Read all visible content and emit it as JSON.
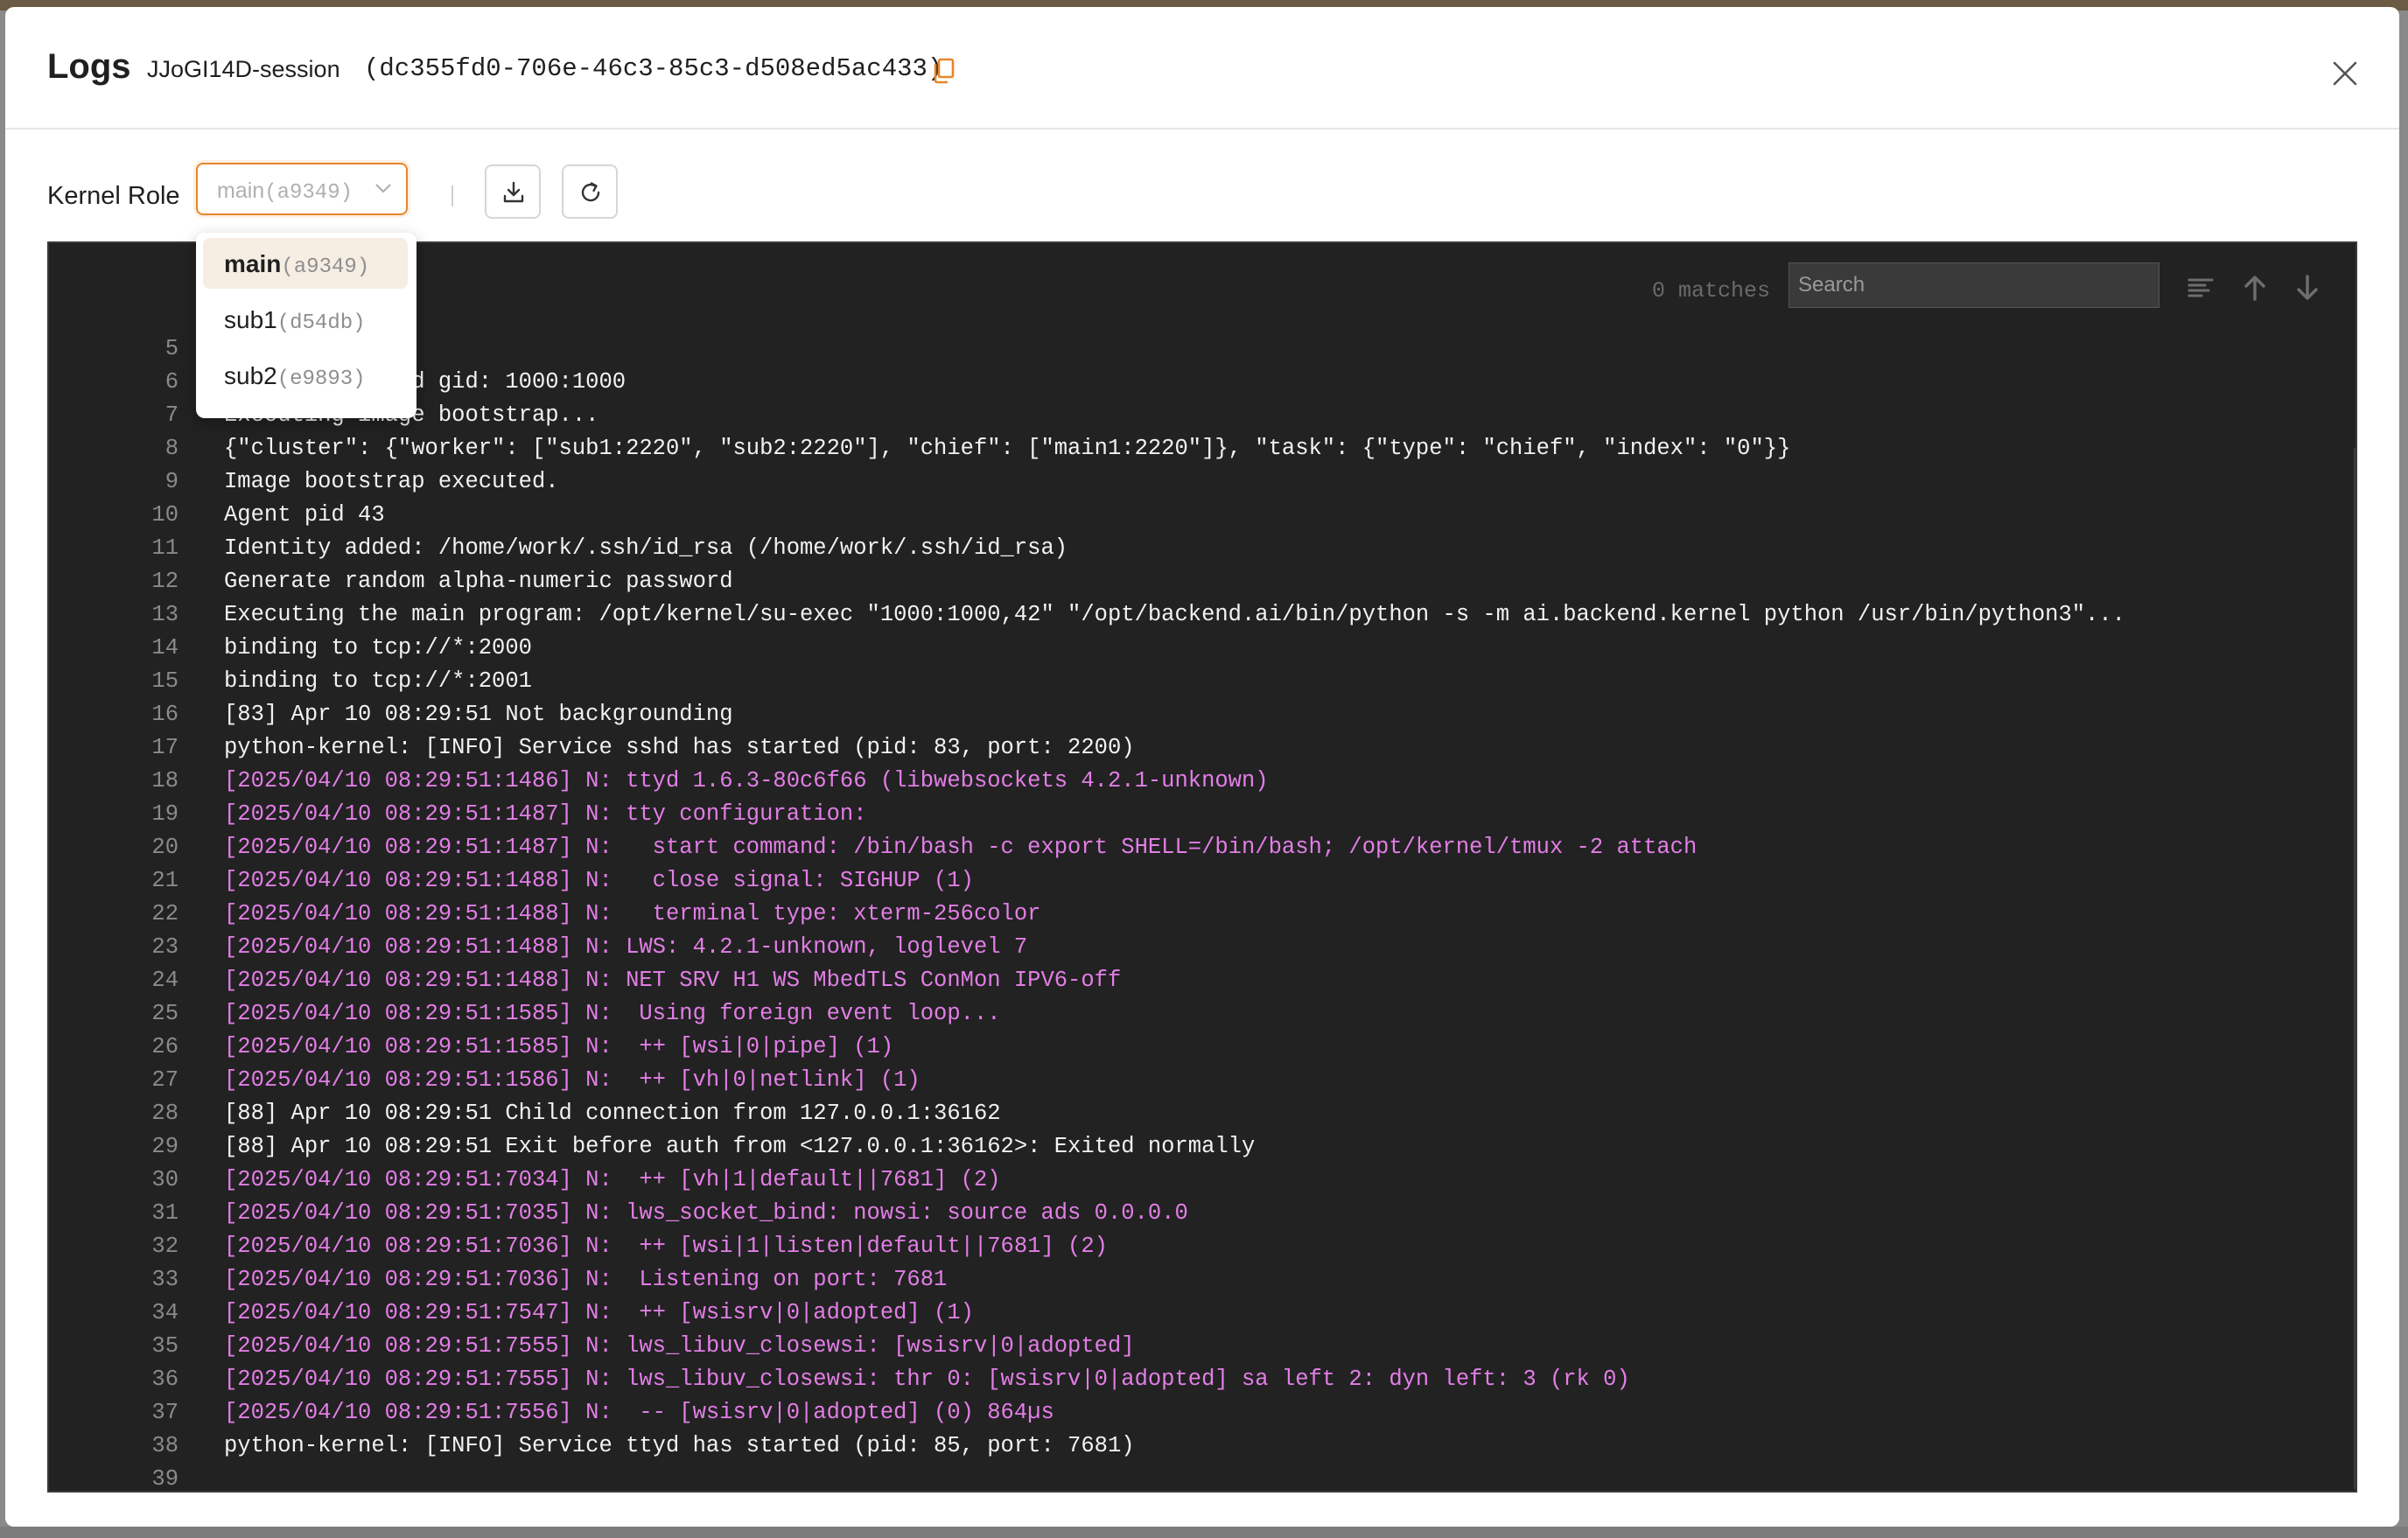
{
  "modal": {
    "title": "Logs",
    "session_name": "JJoGI14D-session",
    "session_id": "(dc355fd0-706e-46c3-85c3-d508ed5ac433)"
  },
  "toolbar": {
    "kernel_role_label": "Kernel Role",
    "selected_role": {
      "name": "main",
      "id": "(a9349)"
    }
  },
  "role_options": [
    {
      "name": "main",
      "id": "(a9349)",
      "selected": true
    },
    {
      "name": "sub1",
      "id": "(d54db)",
      "selected": false
    },
    {
      "name": "sub2",
      "id": "(e9893)",
      "selected": false
    }
  ],
  "log_search": {
    "matches": "0 matches",
    "placeholder": "Search"
  },
  "colors": {
    "accent": "#e8862a",
    "log_background": "#222222",
    "log_text": "#f2f2f2",
    "log_highlight": "#e27ee6",
    "line_number": "#8a8a8a"
  },
  "log_lines": [
    {
      "n": "5",
      "text": "",
      "pink": false
    },
    {
      "n": "6",
      "text": "Setting uid and gid: 1000:1000",
      "pink": false
    },
    {
      "n": "7",
      "text": "Executing image bootstrap...",
      "pink": false
    },
    {
      "n": "8",
      "text": "{\"cluster\": {\"worker\": [\"sub1:2220\", \"sub2:2220\"], \"chief\": [\"main1:2220\"]}, \"task\": {\"type\": \"chief\", \"index\": \"0\"}}",
      "pink": false
    },
    {
      "n": "9",
      "text": "Image bootstrap executed.",
      "pink": false
    },
    {
      "n": "10",
      "text": "Agent pid 43",
      "pink": false
    },
    {
      "n": "11",
      "text": "Identity added: /home/work/.ssh/id_rsa (/home/work/.ssh/id_rsa)",
      "pink": false
    },
    {
      "n": "12",
      "text": "Generate random alpha-numeric password",
      "pink": false
    },
    {
      "n": "13",
      "text": "Executing the main program: /opt/kernel/su-exec \"1000:1000,42\" \"/opt/backend.ai/bin/python -s -m ai.backend.kernel python /usr/bin/python3\"...",
      "pink": false
    },
    {
      "n": "14",
      "text": "binding to tcp://*:2000",
      "pink": false
    },
    {
      "n": "15",
      "text": "binding to tcp://*:2001",
      "pink": false
    },
    {
      "n": "16",
      "text": "[83] Apr 10 08:29:51 Not backgrounding",
      "pink": false
    },
    {
      "n": "17",
      "text": "python-kernel: [INFO] Service sshd has started (pid: 83, port: 2200)",
      "pink": false
    },
    {
      "n": "18",
      "text": "[2025/04/10 08:29:51:1486] N: ttyd 1.6.3-80c6f66 (libwebsockets 4.2.1-unknown)",
      "pink": true
    },
    {
      "n": "19",
      "text": "[2025/04/10 08:29:51:1487] N: tty configuration:",
      "pink": true
    },
    {
      "n": "20",
      "text": "[2025/04/10 08:29:51:1487] N:   start command: /bin/bash -c export SHELL=/bin/bash; /opt/kernel/tmux -2 attach",
      "pink": true
    },
    {
      "n": "21",
      "text": "[2025/04/10 08:29:51:1488] N:   close signal: SIGHUP (1)",
      "pink": true
    },
    {
      "n": "22",
      "text": "[2025/04/10 08:29:51:1488] N:   terminal type: xterm-256color",
      "pink": true
    },
    {
      "n": "23",
      "text": "[2025/04/10 08:29:51:1488] N: LWS: 4.2.1-unknown, loglevel 7",
      "pink": true
    },
    {
      "n": "24",
      "text": "[2025/04/10 08:29:51:1488] N: NET SRV H1 WS MbedTLS ConMon IPV6-off",
      "pink": true
    },
    {
      "n": "25",
      "text": "[2025/04/10 08:29:51:1585] N:  Using foreign event loop...",
      "pink": true
    },
    {
      "n": "26",
      "text": "[2025/04/10 08:29:51:1585] N:  ++ [wsi|0|pipe] (1)",
      "pink": true
    },
    {
      "n": "27",
      "text": "[2025/04/10 08:29:51:1586] N:  ++ [vh|0|netlink] (1)",
      "pink": true
    },
    {
      "n": "28",
      "text": "[88] Apr 10 08:29:51 Child connection from 127.0.0.1:36162",
      "pink": false
    },
    {
      "n": "29",
      "text": "[88] Apr 10 08:29:51 Exit before auth from <127.0.0.1:36162>: Exited normally",
      "pink": false
    },
    {
      "n": "30",
      "text": "[2025/04/10 08:29:51:7034] N:  ++ [vh|1|default||7681] (2)",
      "pink": true
    },
    {
      "n": "31",
      "text": "[2025/04/10 08:29:51:7035] N: lws_socket_bind: nowsi: source ads 0.0.0.0",
      "pink": true
    },
    {
      "n": "32",
      "text": "[2025/04/10 08:29:51:7036] N:  ++ [wsi|1|listen|default||7681] (2)",
      "pink": true
    },
    {
      "n": "33",
      "text": "[2025/04/10 08:29:51:7036] N:  Listening on port: 7681",
      "pink": true
    },
    {
      "n": "34",
      "text": "[2025/04/10 08:29:51:7547] N:  ++ [wsisrv|0|adopted] (1)",
      "pink": true
    },
    {
      "n": "35",
      "text": "[2025/04/10 08:29:51:7555] N: lws_libuv_closewsi: [wsisrv|0|adopted]",
      "pink": true
    },
    {
      "n": "36",
      "text": "[2025/04/10 08:29:51:7555] N: lws_libuv_closewsi: thr 0: [wsisrv|0|adopted] sa left 2: dyn left: 3 (rk 0)",
      "pink": true
    },
    {
      "n": "37",
      "text": "[2025/04/10 08:29:51:7556] N:  -- [wsisrv|0|adopted] (0) 864µs",
      "pink": true
    },
    {
      "n": "38",
      "text": "python-kernel: [INFO] Service ttyd has started (pid: 85, port: 7681)",
      "pink": false
    },
    {
      "n": "39",
      "text": "",
      "pink": false
    }
  ]
}
